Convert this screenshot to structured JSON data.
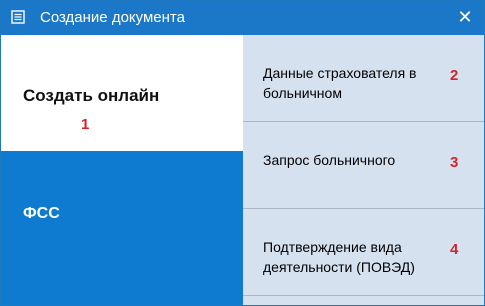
{
  "window": {
    "title": "Создание документа",
    "close_glyph": "✕",
    "icon": "document-icon",
    "accent_color": "#1b78c8"
  },
  "left": {
    "online_label": "Создать онлайн",
    "fss_label": "ФСС",
    "selected_color": "#0f7bd0"
  },
  "options": [
    {
      "label": "Данные страхователя в больничном",
      "number": "2"
    },
    {
      "label": "Запрос больничного",
      "number": "3"
    },
    {
      "label": "Подтверждение вида деятельности (ПОВЭД)",
      "number": "4"
    }
  ],
  "annotations": {
    "online_number": "1",
    "color": "#d2242a"
  }
}
